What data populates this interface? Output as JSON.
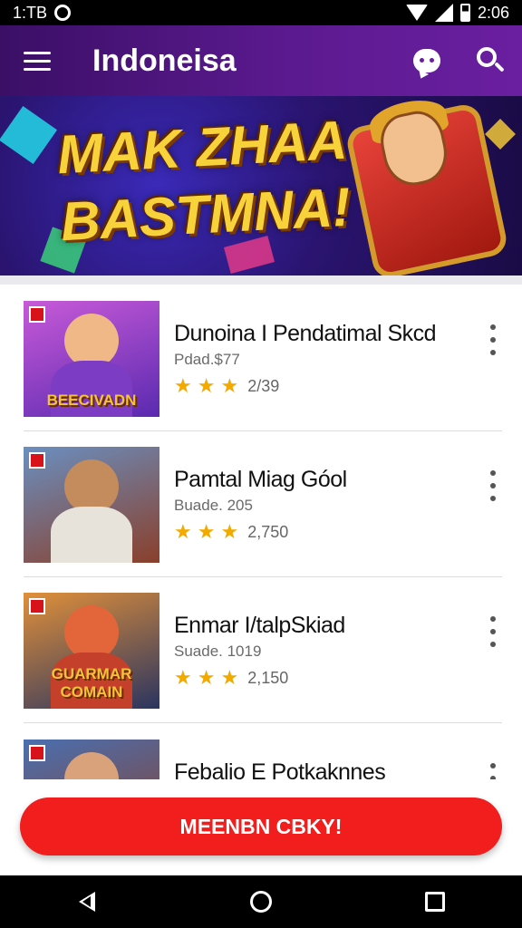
{
  "status_bar": {
    "time_left": "1:TB",
    "time_right": "2:06"
  },
  "app_bar": {
    "title": "Indoneisa"
  },
  "banner": {
    "headline_line1": "MAK ZHAA",
    "headline_line2": "BASTMNA!"
  },
  "games": [
    {
      "title": "Dunoina I Pendatimal Skcd",
      "subtitle": "Pdad.$77",
      "stars": 3,
      "rating_count": "2/39",
      "thumb_caption": "BEECIVADN",
      "thumb_colors": {
        "bg": "#a64fd0",
        "figure": "#f0b887",
        "body": "#7d3cc4"
      }
    },
    {
      "title": "Pamtal Miag Góol",
      "subtitle": "Buade. 205",
      "stars": 3,
      "rating_count": "2,750",
      "thumb_caption": "",
      "thumb_colors": {
        "bg": "#5a7fa8",
        "figure": "#c48b5c",
        "body": "#e7e3da"
      }
    },
    {
      "title": "Enmar I/talpSkiad",
      "subtitle": "Suade. 1019",
      "stars": 3,
      "rating_count": "2,150",
      "thumb_caption": "GUARMAR COMAIN",
      "thumb_colors": {
        "bg": "#3a4a7a",
        "figure": "#e3653a",
        "body": "#c4402a"
      }
    },
    {
      "title": "Febalio E Potkaknnes",
      "subtitle": "",
      "stars": 0,
      "rating_count": "",
      "thumb_caption": "",
      "thumb_colors": {
        "bg": "#4a6fb0",
        "figure": "#d9a27a",
        "body": "#8a3f2a"
      }
    }
  ],
  "cta": {
    "label": "MEENBN CBKY!"
  },
  "colors": {
    "app_bar": "#5b1a8f",
    "cta": "#f21d1d",
    "star": "#f2a900"
  }
}
